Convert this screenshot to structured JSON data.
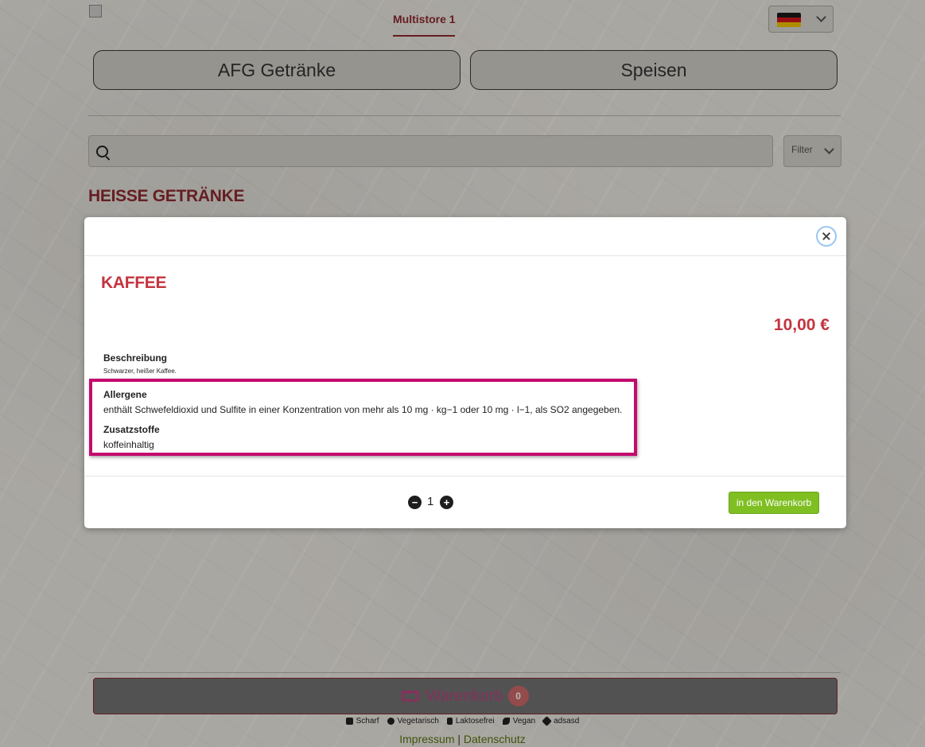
{
  "header": {
    "store_tab": "Multistore 1",
    "language_flag": "german-flag"
  },
  "categories": [
    "AFG Getränke",
    "Speisen"
  ],
  "search": {
    "placeholder": ""
  },
  "filter": {
    "label": "Filter"
  },
  "section_title": "HEISSE GETRÄNKE",
  "modal": {
    "title": "KAFFEE",
    "price": "10,00 €",
    "description_label": "Beschreibung",
    "description_text": "Schwarzer, heißer Kaffee.",
    "allergens_label": "Allergene",
    "allergens_text": "enthält Schwefeldioxid und Sulfite in einer Konzentration von mehr als 10 mg · kg−1 oder 10 mg · l−1, als SO2 angegeben.",
    "additives_label": "Zusatzstoffe",
    "additives_text": "koffeinhaltig",
    "quantity": "1",
    "add_to_cart": "in den Warenkorb"
  },
  "footer": {
    "cart_label": "Warenkorb",
    "cart_count": "0",
    "legend": [
      "Scharf",
      "Vegetarisch",
      "Laktosefrei",
      "Vegan",
      "adsasd"
    ],
    "impressum": "Impressum",
    "separator": "|",
    "datenschutz": "Datenschutz"
  },
  "colors": {
    "brand_red": "#c4343f",
    "highlight": "#c40a6e",
    "add_button": "#7fbf22"
  }
}
